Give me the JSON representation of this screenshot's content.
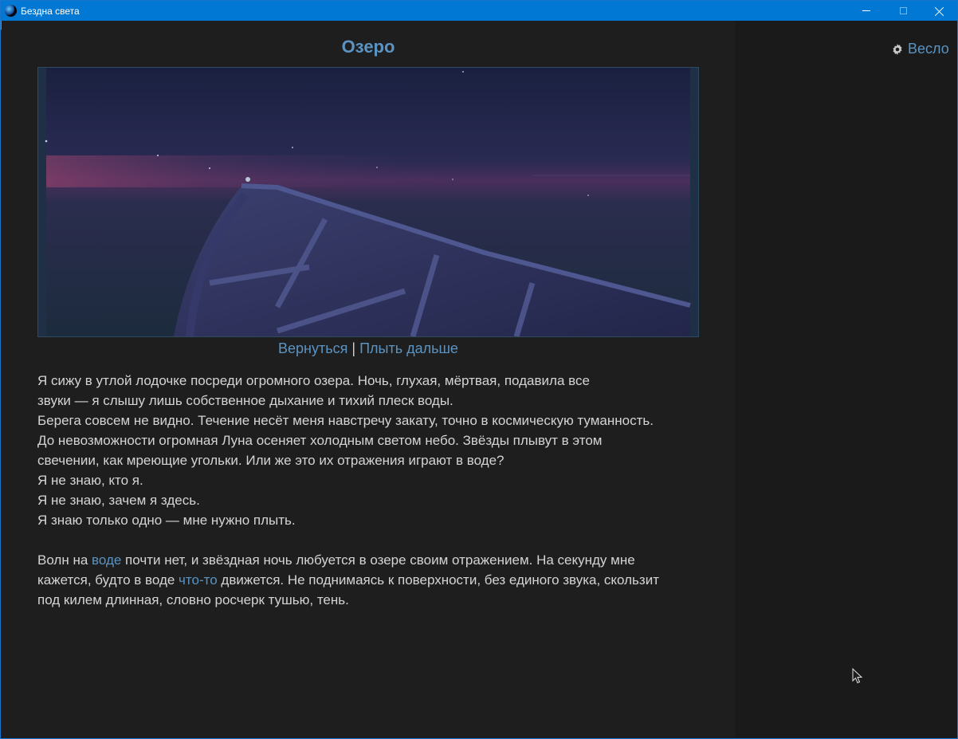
{
  "window": {
    "title": "Бездна света",
    "icon": "app-globe-icon",
    "accent": "#0078d4"
  },
  "passage": {
    "title": "Озеро"
  },
  "image": {
    "description_icon": "night-lake-boat-image"
  },
  "nav": {
    "back_label": "Вернуться",
    "separator": "|",
    "forward_label": "Плыть дальше"
  },
  "story": {
    "lines": [
      "Я сижу в утлой лодочке посреди огромного озера. Ночь, глухая, мёртвая, подавила все",
      "звуки — я слышу лишь собственное дыхание и тихий плеск воды.",
      "Берега совсем не видно. Течение несёт меня навстречу закату, точно в космическую туманность.",
      "До невозможности огромная Луна осеняет холодным светом небо. Звёзды плывут в этом",
      "свечении, как мреющие угольки. Или же это их отражения играют в воде?",
      "Я не знаю, кто я.",
      "Я не знаю, зачем я здесь.",
      "Я знаю только одно — мне нужно плыть."
    ],
    "para2": {
      "part1": "Волн на ",
      "link1": "воде",
      "part2": " почти нет, и звёздная ночь любуется в озере своим отражением. На секунду мне",
      "part3": "кажется, будто в воде ",
      "link2": "что-то",
      "part4": " движется. Не поднимаясь к поверхности, без единого звука, скользит",
      "part5": "под килем длинная, словно росчерк тушью, тень."
    }
  },
  "sidebar": {
    "inventory_label": "Весло",
    "inventory_icon": "gear-icon"
  },
  "colors": {
    "link": "#5b93c2",
    "text": "#d4d4d4",
    "background": "#1e1e1e"
  }
}
